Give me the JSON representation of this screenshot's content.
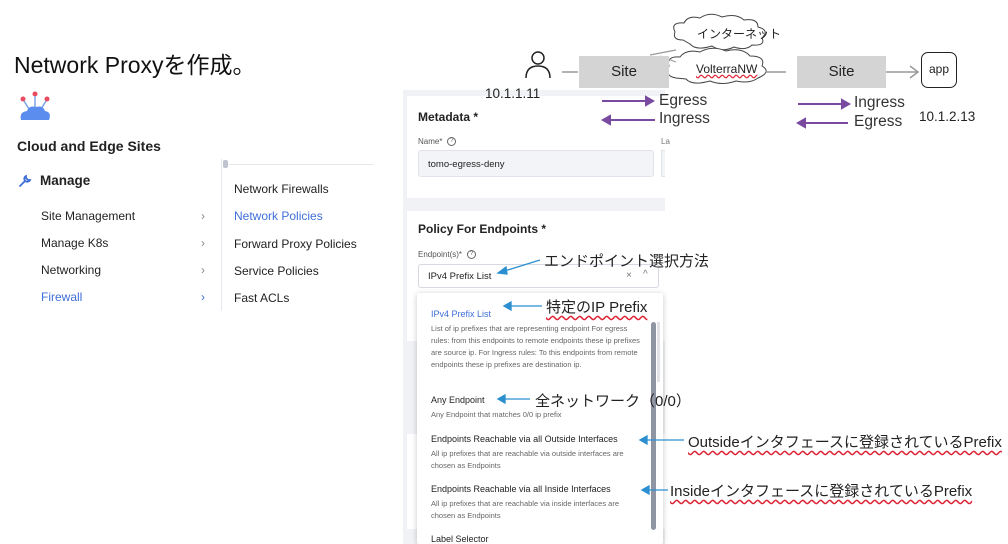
{
  "slide": {
    "title": "Network Proxyを作成。"
  },
  "sidebar": {
    "section_title": "Cloud and Edge Sites",
    "manage_label": "Manage",
    "items": [
      {
        "label": "Site Management"
      },
      {
        "label": "Manage K8s"
      },
      {
        "label": "Networking"
      },
      {
        "label": "Firewall"
      }
    ],
    "submenu": [
      {
        "label": "Network Firewalls"
      },
      {
        "label": "Network Policies"
      },
      {
        "label": "Forward Proxy Policies"
      },
      {
        "label": "Service Policies"
      },
      {
        "label": "Fast ACLs"
      }
    ]
  },
  "form": {
    "metadata_title": "Metadata *",
    "name_label": "Name*",
    "name_value": "tomo-egress-deny",
    "labels_label_fragment": "La",
    "endpoints_title": "Policy For Endpoints *",
    "endpoints_label": "Endpoint(s)*",
    "endpoints_value": "IPv4 Prefix List",
    "clear_glyph": "×",
    "up_glyph": "^"
  },
  "dropdown": {
    "options": [
      {
        "title": "IPv4 Prefix List",
        "desc": "List of ip prefixes that are representing endpoint For egress rules: from this endpoints to remote endpoints these ip prefixes are source ip. For Ingress rules: To this endpoints from remote endpoints these ip prefixes are destination ip."
      },
      {
        "title": "Any Endpoint",
        "desc": "Any Endpoint that matches 0/0 ip prefix"
      },
      {
        "title": "Endpoints Reachable via all Outside Interfaces",
        "desc": "All ip prefixes that are reachable via outside interfaces are chosen as Endpoints"
      },
      {
        "title": "Endpoints Reachable via all Inside Interfaces",
        "desc": "All ip prefixes that are reachable via inside interfaces are chosen as Endpoints"
      },
      {
        "title": "Label Selector",
        "desc": ""
      }
    ]
  },
  "diagram": {
    "cloud_internet": "インターネット",
    "cloud_volterra": "VolterraNW",
    "site_left": "Site",
    "site_right": "Site",
    "app": "app",
    "ip_left": "10.1.1.11",
    "ip_right": "10.1.2.13",
    "left_out": "Egress",
    "left_in": "Ingress",
    "right_out": "Ingress",
    "right_in": "Egress"
  },
  "annotations": {
    "endpoint_method": "エンドポイント選択方法",
    "specific_prefix": "特定のIP Prefix",
    "all_network": "全ネットワーク（0/0）",
    "outside": "Outsideインタフェースに登録されているPrefix",
    "inside": "Insideインタフェースに登録されているPrefix"
  },
  "colors": {
    "accent_blue": "#3f6fd8",
    "arrow_purple": "#7a4aa0",
    "annotation_arrow": "#2b8fd0"
  }
}
